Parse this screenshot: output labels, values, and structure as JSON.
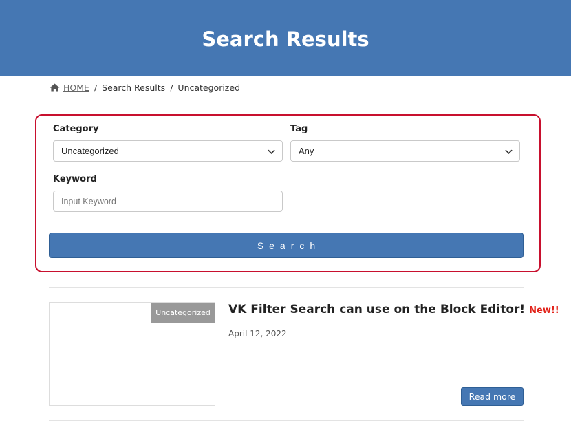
{
  "header": {
    "title": "Search Results"
  },
  "breadcrumb": {
    "home": "HOME",
    "separator": "/",
    "items": [
      "Search Results",
      "Uncategorized"
    ]
  },
  "search_form": {
    "category": {
      "label": "Category",
      "value": "Uncategorized"
    },
    "tag": {
      "label": "Tag",
      "value": "Any"
    },
    "keyword": {
      "label": "Keyword",
      "placeholder": "Input Keyword"
    },
    "submit_label": "Search"
  },
  "posts": [
    {
      "category_badge": "Uncategorized",
      "title": "VK Filter Search can use on the Block Editor!",
      "new_label": "New!!",
      "date": "April 12, 2022",
      "read_more": "Read more"
    }
  ],
  "colors": {
    "primary": "#4577b3",
    "form_border": "#c8102e",
    "new_label": "#e2231a",
    "badge_bg": "#999999"
  },
  "icons": {
    "breadcrumb_home": "home-icon",
    "select_arrow": "chevron-down-icon"
  }
}
